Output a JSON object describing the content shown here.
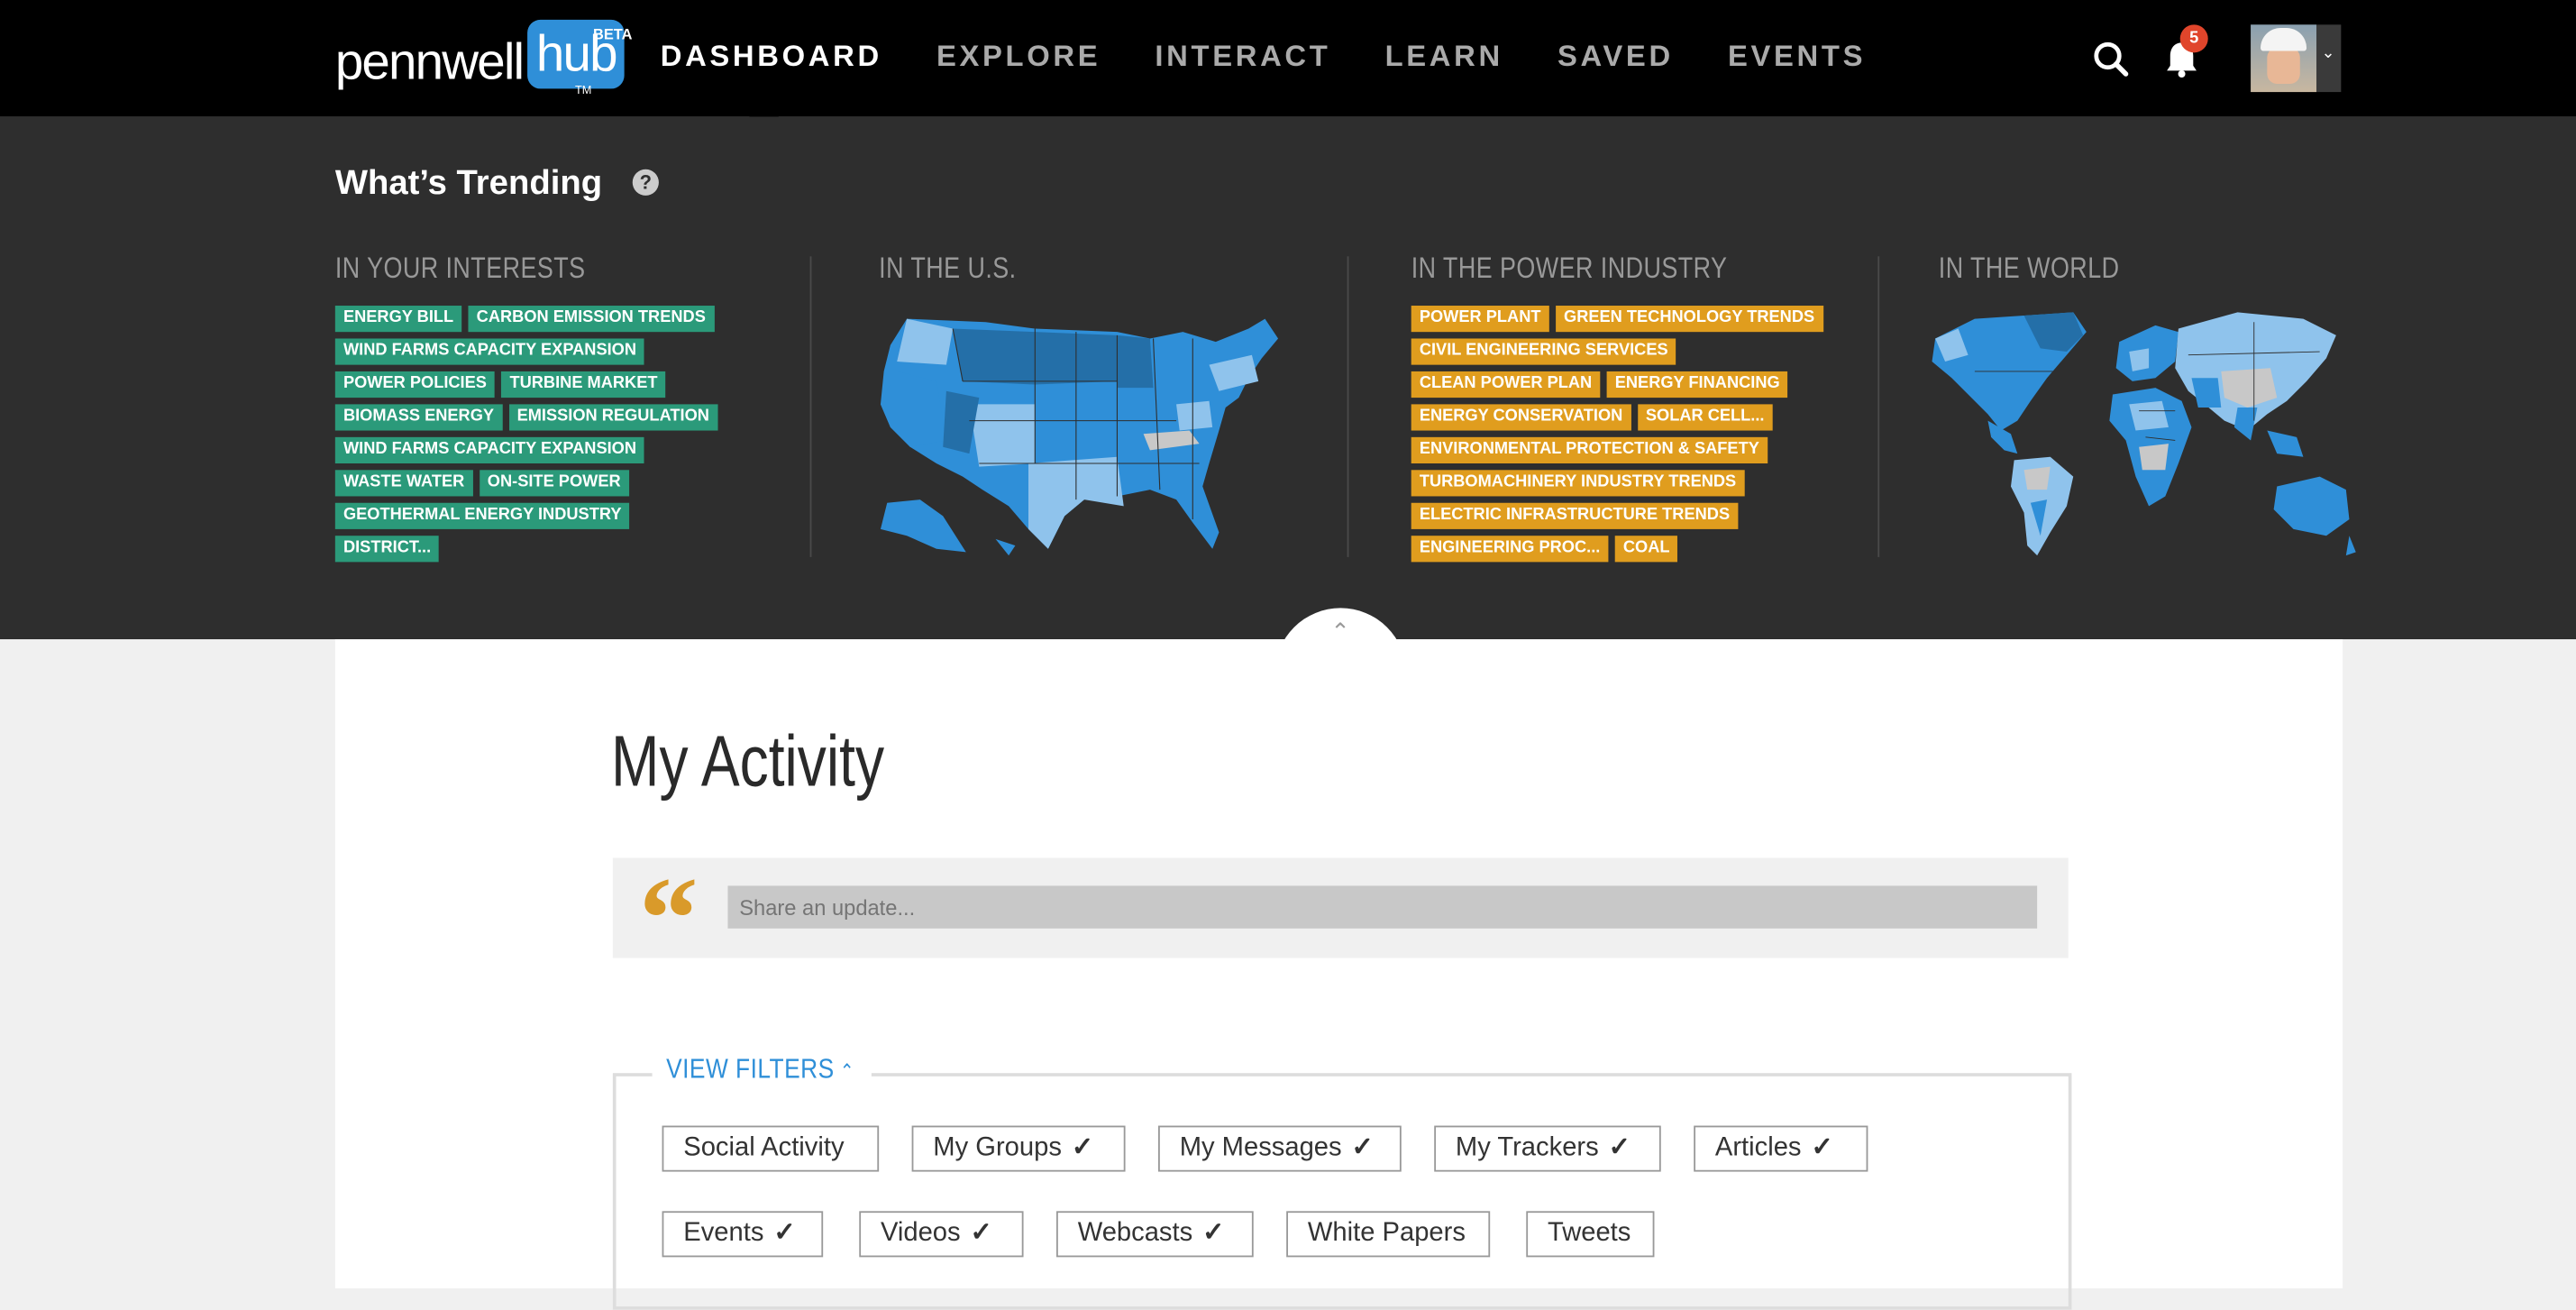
{
  "header": {
    "logo_text": "pennwell",
    "logo_box": "hub",
    "beta": "BETA",
    "tm": "TM",
    "nav": [
      "DASHBOARD",
      "EXPLORE",
      "INTERACT",
      "LEARN",
      "SAVED",
      "EVENTS"
    ],
    "active_nav": "DASHBOARD",
    "notifications_count": "5"
  },
  "trending": {
    "title": "What’s Trending",
    "help": "?",
    "columns": {
      "interests": "IN YOUR INTERESTS",
      "us": "IN THE U.S.",
      "power": "IN THE POWER INDUSTRY",
      "world": "IN THE WORLD"
    },
    "interest_tags": [
      "ENERGY BILL",
      "CARBON EMISSION TRENDS",
      "WIND FARMS CAPACITY EXPANSION",
      "POWER POLICIES",
      "TURBINE MARKET",
      "BIOMASS ENERGY",
      "EMISSION REGULATION",
      "WIND FARMS CAPACITY EXPANSION",
      "WASTE WATER",
      "ON-SITE POWER",
      "GEOTHERMAL ENERGY INDUSTRY",
      "DISTRICT..."
    ],
    "power_tags": [
      "POWER PLANT",
      "GREEN TECHNOLOGY TRENDS",
      "CIVIL ENGINEERING SERVICES",
      "CLEAN POWER PLAN",
      "ENERGY FINANCING",
      "ENERGY CONSERVATION",
      "SOLAR CELL...",
      "ENVIRONMENTAL PROTECTION & SAFETY",
      "TURBOMACHINERY INDUSTRY TRENDS",
      "ELECTRIC INFRASTRUCTURE TRENDS",
      "ENGINEERING PROC...",
      "COAL"
    ],
    "colors": {
      "green": "#2b9a7a",
      "orange": "#e09d1e"
    }
  },
  "activity": {
    "title": "My Activity",
    "share_placeholder": "Share an update...",
    "view_filters": "VIEW FILTERS",
    "filters": [
      {
        "label": "Social Activity",
        "checked": false
      },
      {
        "label": "My Groups",
        "checked": true
      },
      {
        "label": "My Messages",
        "checked": true
      },
      {
        "label": "My Trackers",
        "checked": true
      },
      {
        "label": "Articles",
        "checked": true
      },
      {
        "label": "Events",
        "checked": true
      },
      {
        "label": "Videos",
        "checked": true
      },
      {
        "label": "Webcasts",
        "checked": true
      },
      {
        "label": "White Papers",
        "checked": false
      },
      {
        "label": "Tweets",
        "checked": false
      }
    ]
  }
}
